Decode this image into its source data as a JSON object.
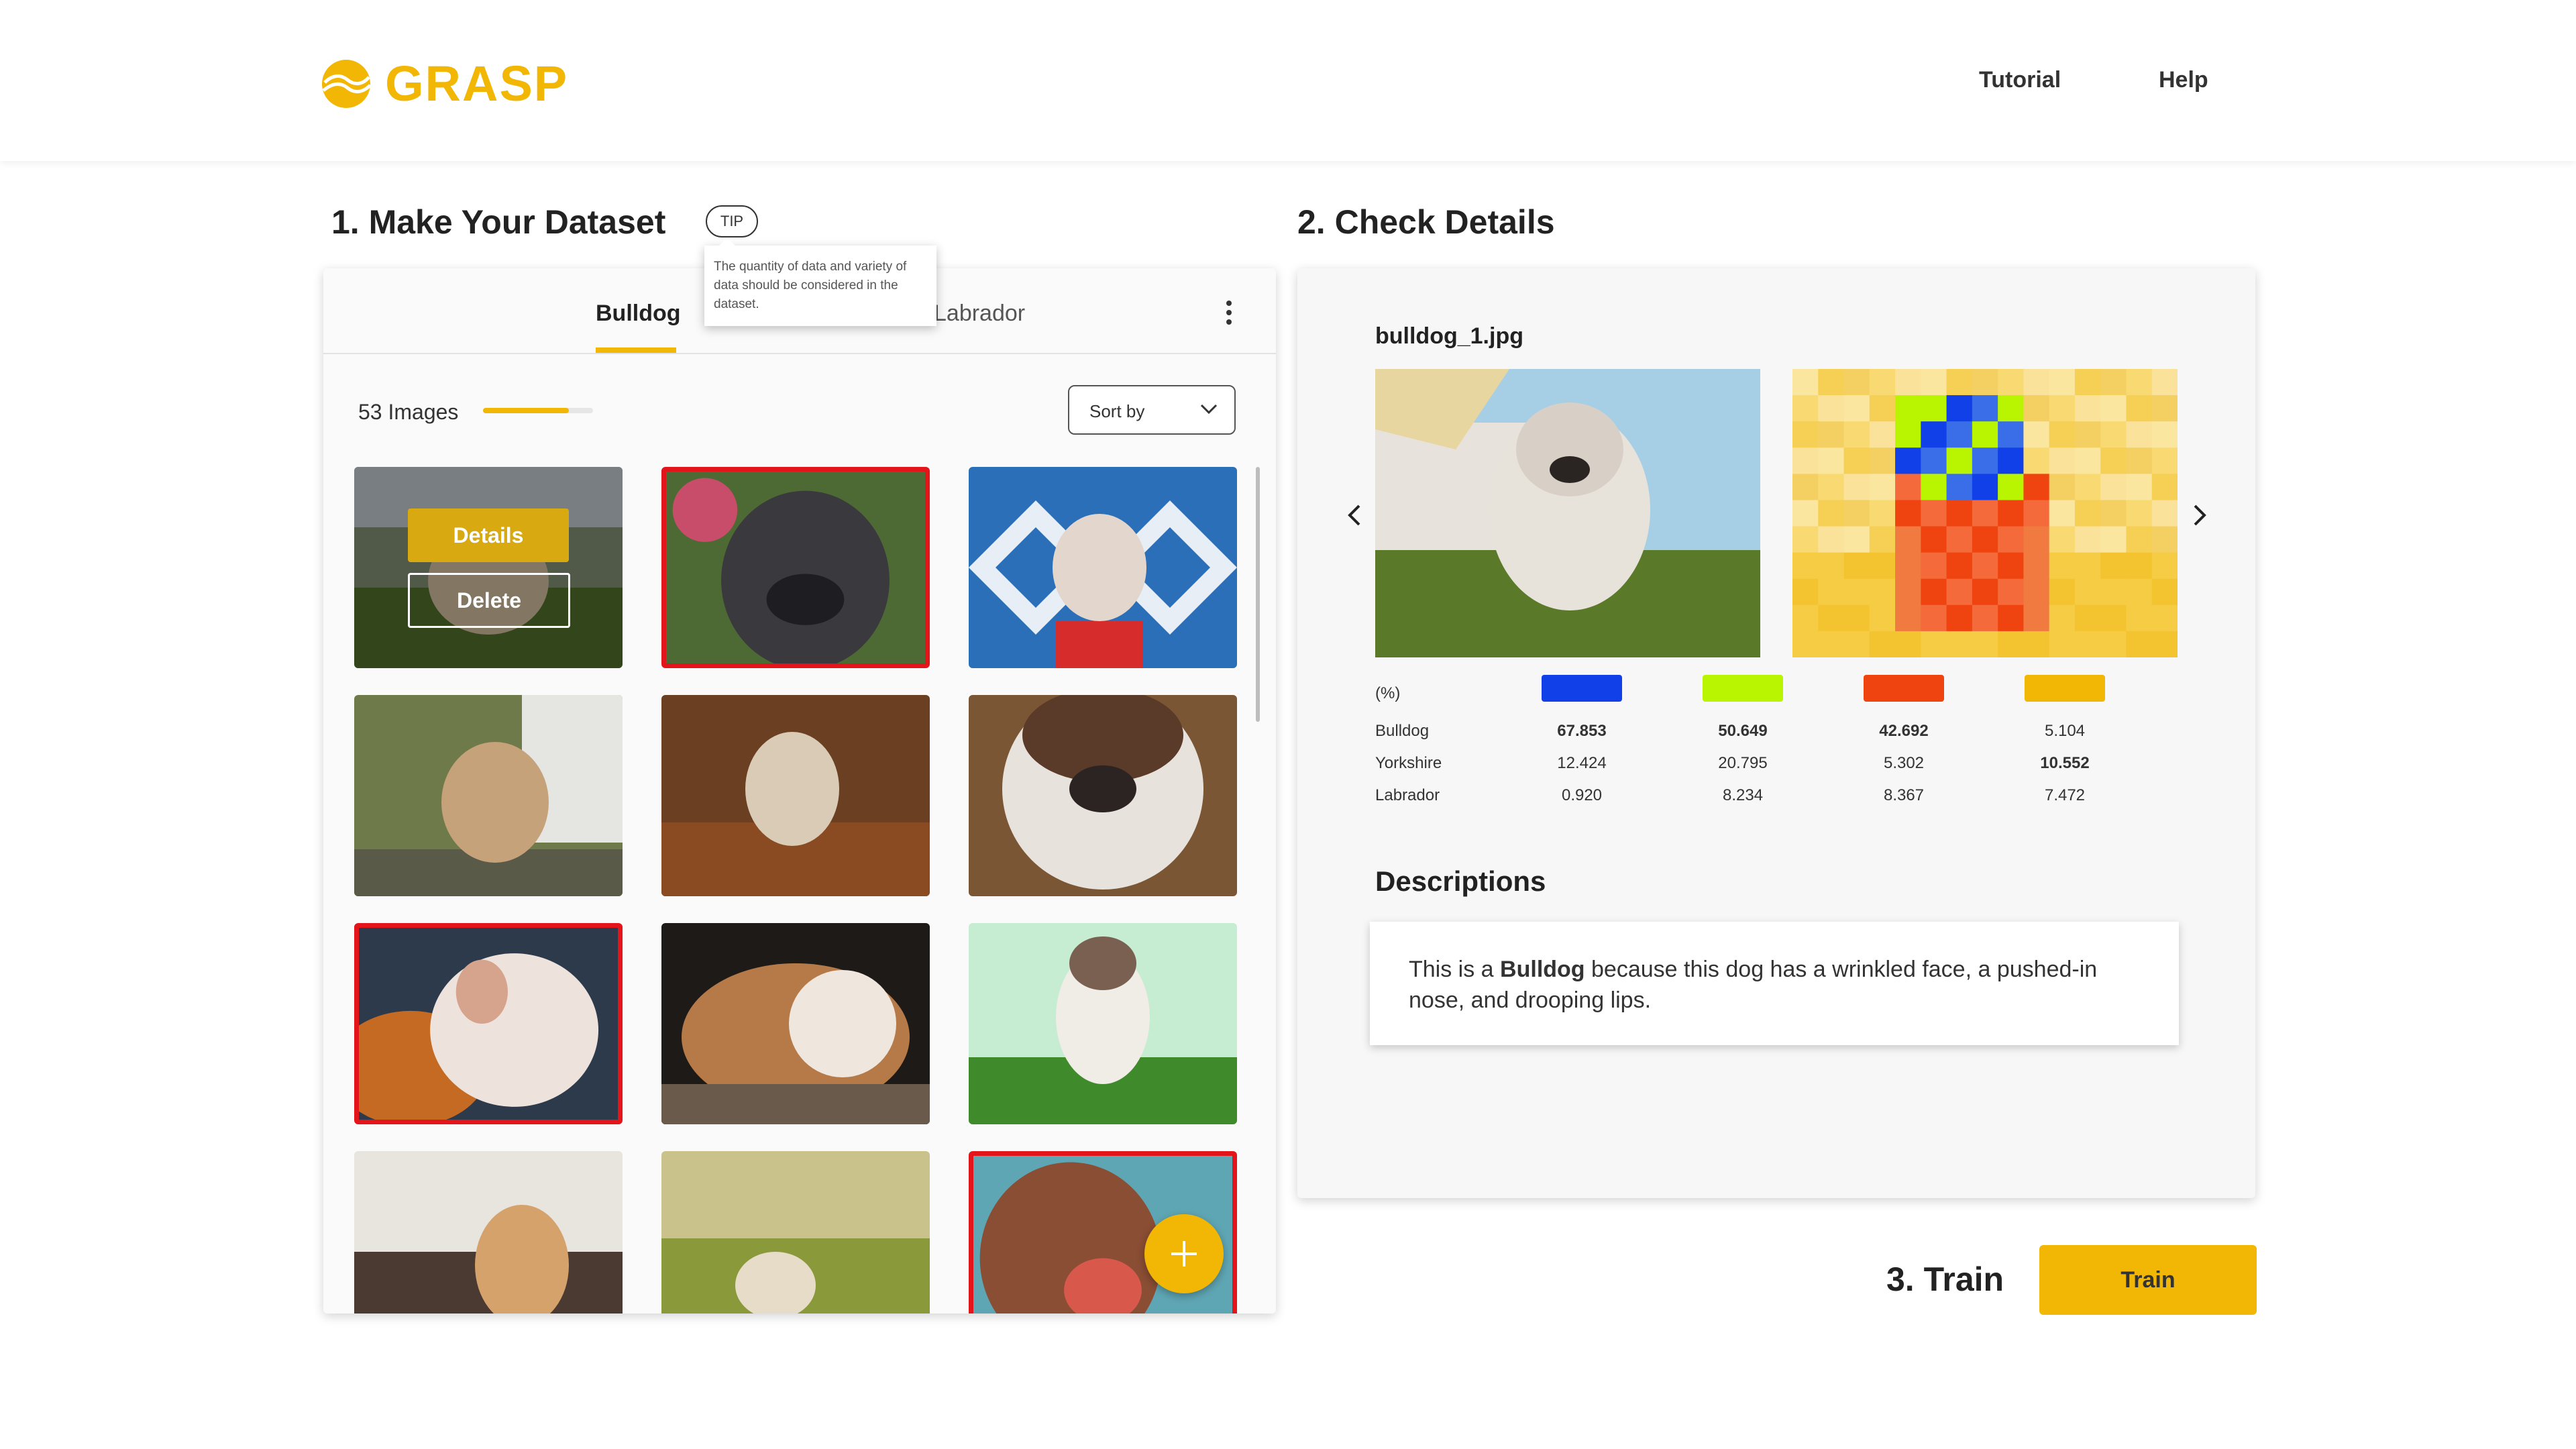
{
  "header": {
    "logo_text": "GRASP",
    "nav": {
      "tutorial": "Tutorial",
      "help": "Help"
    }
  },
  "section1": {
    "title": "1. Make Your Dataset",
    "tip_label": "TIP",
    "tip_text": "The quantity of data and variety of data should be considered in the dataset.",
    "tabs": {
      "active": "Bulldog",
      "other": "Labrador"
    },
    "image_count": "53 Images",
    "progress": 0.78,
    "sort_label": "Sort by",
    "thumb_actions": {
      "details": "Details",
      "delete": "Delete"
    }
  },
  "section2": {
    "title": "2. Check Details",
    "file_name": "bulldog_1.jpg",
    "percent_label": "(%)",
    "swatch_colors": [
      "#1240e8",
      "#b9f500",
      "#f04410",
      "#f2b705"
    ],
    "rows": [
      {
        "label": "Bulldog",
        "values": [
          "67.853",
          "50.649",
          "42.692",
          "5.104"
        ],
        "bold": [
          true,
          true,
          true,
          false
        ]
      },
      {
        "label": "Yorkshire",
        "values": [
          "12.424",
          "20.795",
          "5.302",
          "10.552"
        ],
        "bold": [
          false,
          false,
          false,
          true
        ]
      },
      {
        "label": "Labrador",
        "values": [
          "0.920",
          "8.234",
          "8.367",
          "7.472"
        ],
        "bold": [
          false,
          false,
          false,
          false
        ]
      }
    ],
    "descriptions_title": "Descriptions",
    "description": {
      "prefix": "This is a ",
      "breed": "Bulldog",
      "suffix": " because this dog has a wrinkled face, a pushed-in nose, and drooping lips."
    }
  },
  "section3": {
    "title": "3. Train",
    "button": "Train"
  },
  "colors": {
    "accent": "#f2b705",
    "flag": "#e4151a"
  },
  "icons": [
    "logo-icon",
    "kebab-menu-icon",
    "chevron-down-icon",
    "chevron-left-icon",
    "chevron-right-icon",
    "plus-icon"
  ]
}
